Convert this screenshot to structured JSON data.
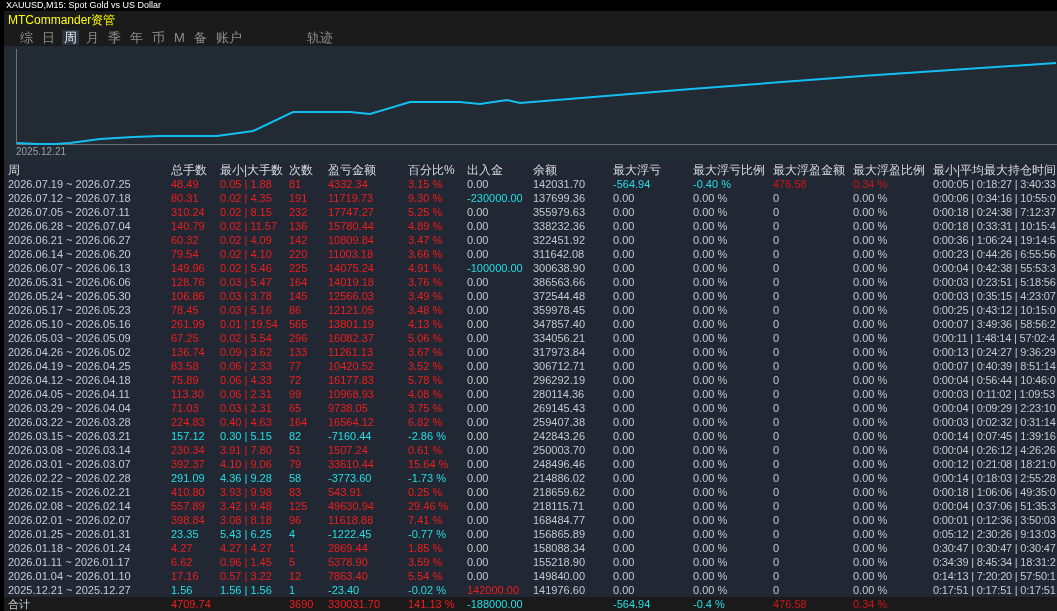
{
  "chart_window": {
    "title": "XAUUSD,M15: Spot Gold vs US Dollar"
  },
  "panel": {
    "title": "MTCommander资管"
  },
  "tabs": [
    {
      "label": "综",
      "selected": false
    },
    {
      "label": "日",
      "selected": false
    },
    {
      "label": "周",
      "selected": true
    },
    {
      "label": "月",
      "selected": false
    },
    {
      "label": "季",
      "selected": false
    },
    {
      "label": "年",
      "selected": false
    },
    {
      "label": "币",
      "selected": false
    },
    {
      "label": "M",
      "selected": false
    },
    {
      "label": "备",
      "selected": false
    },
    {
      "label": "账户",
      "selected": false
    }
  ],
  "trace_button": {
    "label": "轨迹"
  },
  "chart": {
    "start_label": "2025.12.21"
  },
  "table": {
    "columns": [
      "周",
      "总手数",
      "最小|大手数",
      "次数",
      "盈亏金额",
      "百分比%",
      "出入金",
      "余额",
      "最大浮亏",
      "最大浮亏比例",
      "最大浮盈金额",
      "最大浮盈比例",
      "最小|平均最大持仓时间"
    ],
    "rows": [
      {
        "cells": [
          "2026.07.19 ~ 2026.07.25",
          "48.49",
          "0.05 | 1.88",
          "81",
          "4332.34",
          "3.15 %",
          "0.00",
          "142031.70",
          "-564.94",
          "-0.40 %",
          "476.58",
          "0.34 %",
          "0:00:05 | 0:18:27 | 3:40:33"
        ],
        "loss": false,
        "deposit": false,
        "withdrawal": false,
        "has_floating": true
      },
      {
        "cells": [
          "2026.07.12 ~ 2026.07.18",
          "80.31",
          "0.02 | 4.35",
          "191",
          "11719.73",
          "9.30 %",
          "-230000.00",
          "137699.36",
          "0.00",
          "0.00 %",
          "0",
          "0.00 %",
          "0:00:06 | 0:34:16 | 10:55:0"
        ],
        "loss": false,
        "deposit": false,
        "withdrawal": true,
        "has_floating": false
      },
      {
        "cells": [
          "2026.07.05 ~ 2026.07.11",
          "310.24",
          "0.02 | 8.15",
          "232",
          "17747.27",
          "5.25 %",
          "0.00",
          "355979.63",
          "0.00",
          "0.00 %",
          "0",
          "0.00 %",
          "0:00:18 | 0:24:38 | 7:12:37"
        ],
        "loss": false,
        "deposit": false,
        "withdrawal": false,
        "has_floating": false
      },
      {
        "cells": [
          "2026.06.28 ~ 2026.07.04",
          "140.79",
          "0.02 | 11.57",
          "136",
          "15780.44",
          "4.89 %",
          "0.00",
          "338232.36",
          "0.00",
          "0.00 %",
          "0",
          "0.00 %",
          "0:00:18 | 0:33:31 | 10:15:4"
        ],
        "loss": false,
        "deposit": false,
        "withdrawal": false,
        "has_floating": false
      },
      {
        "cells": [
          "2026.06.21 ~ 2026.06.27",
          "60.32",
          "0.02 | 4.09",
          "142",
          "10809.84",
          "3.47 %",
          "0.00",
          "322451.92",
          "0.00",
          "0.00 %",
          "0",
          "0.00 %",
          "0:00:36 | 1:06:24 | 19:14:5"
        ],
        "loss": false,
        "deposit": false,
        "withdrawal": false,
        "has_floating": false
      },
      {
        "cells": [
          "2026.06.14 ~ 2026.06.20",
          "79.54",
          "0.02 | 4.10",
          "220",
          "11003.18",
          "3.66 %",
          "0.00",
          "311642.08",
          "0.00",
          "0.00 %",
          "0",
          "0.00 %",
          "0:00:23 | 0:44:26 | 6:55:56"
        ],
        "loss": false,
        "deposit": false,
        "withdrawal": false,
        "has_floating": false
      },
      {
        "cells": [
          "2026.06.07 ~ 2026.06.13",
          "149.96",
          "0.02 | 5.46",
          "225",
          "14075.24",
          "4.91 %",
          "-100000.00",
          "300638.90",
          "0.00",
          "0.00 %",
          "0",
          "0.00 %",
          "0:00:04 | 0:42:38 | 55:53:3"
        ],
        "loss": false,
        "deposit": false,
        "withdrawal": true,
        "has_floating": false
      },
      {
        "cells": [
          "2026.05.31 ~ 2026.06.06",
          "128.76",
          "0.03 | 5.47",
          "164",
          "14019.18",
          "3.76 %",
          "0.00",
          "386563.66",
          "0.00",
          "0.00 %",
          "0",
          "0.00 %",
          "0:00:03 | 0:23:51 | 5:18:56"
        ],
        "loss": false,
        "deposit": false,
        "withdrawal": false,
        "has_floating": false
      },
      {
        "cells": [
          "2026.05.24 ~ 2026.05.30",
          "106.86",
          "0.03 | 3.78",
          "145",
          "12566.03",
          "3.49 %",
          "0.00",
          "372544.48",
          "0.00",
          "0.00 %",
          "0",
          "0.00 %",
          "0:00:03 | 0:35:15 | 4:23:07"
        ],
        "loss": false,
        "deposit": false,
        "withdrawal": false,
        "has_floating": false
      },
      {
        "cells": [
          "2026.05.17 ~ 2026.05.23",
          "78.45",
          "0.03 | 5.16",
          "86",
          "12121.05",
          "3.48 %",
          "0.00",
          "359978.45",
          "0.00",
          "0.00 %",
          "0",
          "0.00 %",
          "0:00:25 | 0:43:12 | 10:15:0"
        ],
        "loss": false,
        "deposit": false,
        "withdrawal": false,
        "has_floating": false
      },
      {
        "cells": [
          "2026.05.10 ~ 2026.05.16",
          "261.99",
          "0.01 | 19.54",
          "565",
          "13801.19",
          "4.13 %",
          "0.00",
          "347857.40",
          "0.00",
          "0.00 %",
          "0",
          "0.00 %",
          "0:00:07 | 3:49:36 | 58:56:2"
        ],
        "loss": false,
        "deposit": false,
        "withdrawal": false,
        "has_floating": false
      },
      {
        "cells": [
          "2026.05.03 ~ 2026.05.09",
          "67.25",
          "0.02 | 5.54",
          "296",
          "16082.37",
          "5.06 %",
          "0.00",
          "334056.21",
          "0.00",
          "0.00 %",
          "0",
          "0.00 %",
          "0:00:11 | 1:48:14 | 57:02:4"
        ],
        "loss": false,
        "deposit": false,
        "withdrawal": false,
        "has_floating": false
      },
      {
        "cells": [
          "2026.04.26 ~ 2026.05.02",
          "136.74",
          "0.09 | 3.62",
          "133",
          "11261.13",
          "3.67 %",
          "0.00",
          "317973.84",
          "0.00",
          "0.00 %",
          "0",
          "0.00 %",
          "0:00:13 | 0:24:27 | 9:36:29"
        ],
        "loss": false,
        "deposit": false,
        "withdrawal": false,
        "has_floating": false
      },
      {
        "cells": [
          "2026.04.19 ~ 2026.04.25",
          "83.58",
          "0.06 | 2.33",
          "77",
          "10420.52",
          "3.52 %",
          "0.00",
          "306712.71",
          "0.00",
          "0.00 %",
          "0",
          "0.00 %",
          "0:00:07 | 0:40:39 | 8:51:14"
        ],
        "loss": false,
        "deposit": false,
        "withdrawal": false,
        "has_floating": false
      },
      {
        "cells": [
          "2026.04.12 ~ 2026.04.18",
          "75.89",
          "0.06 | 4.33",
          "72",
          "16177.83",
          "5.78 %",
          "0.00",
          "296292.19",
          "0.00",
          "0.00 %",
          "0",
          "0.00 %",
          "0:00:04 | 0:56:44 | 10:46:0"
        ],
        "loss": false,
        "deposit": false,
        "withdrawal": false,
        "has_floating": false
      },
      {
        "cells": [
          "2026.04.05 ~ 2026.04.11",
          "113.30",
          "0.06 | 2.31",
          "99",
          "10968.93",
          "4.08 %",
          "0.00",
          "280114.36",
          "0.00",
          "0.00 %",
          "0",
          "0.00 %",
          "0:00:03 | 0:11:02 | 1:09:53"
        ],
        "loss": false,
        "deposit": false,
        "withdrawal": false,
        "has_floating": false
      },
      {
        "cells": [
          "2026.03.29 ~ 2026.04.04",
          "71.03",
          "0.03 | 2.31",
          "65",
          "9738.05",
          "3.75 %",
          "0.00",
          "269145.43",
          "0.00",
          "0.00 %",
          "0",
          "0.00 %",
          "0:00:04 | 0:09:29 | 2:23:10"
        ],
        "loss": false,
        "deposit": false,
        "withdrawal": false,
        "has_floating": false
      },
      {
        "cells": [
          "2026.03.22 ~ 2026.03.28",
          "224.83",
          "0.40 | 4.63",
          "164",
          "16564.12",
          "6.82 %",
          "0.00",
          "259407.38",
          "0.00",
          "0.00 %",
          "0",
          "0.00 %",
          "0:00:03 | 0:02:32 | 0:31:14"
        ],
        "loss": false,
        "deposit": false,
        "withdrawal": false,
        "has_floating": false
      },
      {
        "cells": [
          "2026.03.15 ~ 2026.03.21",
          "157.12",
          "0.30 | 5.15",
          "82",
          "-7160.44",
          "-2.86 %",
          "0.00",
          "242843.26",
          "0.00",
          "0.00 %",
          "0",
          "0.00 %",
          "0:00:14 | 0:07:45 | 1:39:16"
        ],
        "loss": true,
        "deposit": false,
        "withdrawal": false,
        "has_floating": false
      },
      {
        "cells": [
          "2026.03.08 ~ 2026.03.14",
          "230.34",
          "3.91 | 7.80",
          "51",
          "1507.24",
          "0.61 %",
          "0.00",
          "250003.70",
          "0.00",
          "0.00 %",
          "0",
          "0.00 %",
          "0:00:04 | 0:26:12 | 4:26:26"
        ],
        "loss": false,
        "deposit": false,
        "withdrawal": false,
        "has_floating": false
      },
      {
        "cells": [
          "2026.03.01 ~ 2026.03.07",
          "392.37",
          "4.10 | 9.06",
          "79",
          "33610.44",
          "15.64 %",
          "0.00",
          "248496.46",
          "0.00",
          "0.00 %",
          "0",
          "0.00 %",
          "0:00:12 | 0:21:08 | 18:21:0"
        ],
        "loss": false,
        "deposit": false,
        "withdrawal": false,
        "has_floating": false
      },
      {
        "cells": [
          "2026.02.22 ~ 2026.02.28",
          "291.09",
          "4.36 | 9.28",
          "58",
          "-3773.60",
          "-1.73 %",
          "0.00",
          "214886.02",
          "0.00",
          "0.00 %",
          "0",
          "0.00 %",
          "0:00:14 | 0:18:03 | 2:55:28"
        ],
        "loss": true,
        "deposit": false,
        "withdrawal": false,
        "has_floating": false
      },
      {
        "cells": [
          "2026.02.15 ~ 2026.02.21",
          "410.80",
          "3.93 | 9.98",
          "83",
          "543.91",
          "0.25 %",
          "0.00",
          "218659.62",
          "0.00",
          "0.00 %",
          "0",
          "0.00 %",
          "0:00:18 | 1:06:06 | 49:35:0"
        ],
        "loss": false,
        "deposit": false,
        "withdrawal": false,
        "has_floating": false
      },
      {
        "cells": [
          "2026.02.08 ~ 2026.02.14",
          "557.89",
          "3.42 | 9.48",
          "125",
          "49630.94",
          "29.46 %",
          "0.00",
          "218115.71",
          "0.00",
          "0.00 %",
          "0",
          "0.00 %",
          "0:00:04 | 0:37:06 | 51:35:3"
        ],
        "loss": false,
        "deposit": false,
        "withdrawal": false,
        "has_floating": false
      },
      {
        "cells": [
          "2026.02.01 ~ 2026.02.07",
          "398.84",
          "3.08 | 8.18",
          "96",
          "11618.88",
          "7.41 %",
          "0.00",
          "168484.77",
          "0.00",
          "0.00 %",
          "0",
          "0.00 %",
          "0:00:01 | 0:12:36 | 3:50:03"
        ],
        "loss": false,
        "deposit": false,
        "withdrawal": false,
        "has_floating": false
      },
      {
        "cells": [
          "2026.01.25 ~ 2026.01.31",
          "23.35",
          "5.43 | 6.25",
          "4",
          "-1222.45",
          "-0.77 %",
          "0.00",
          "156865.89",
          "0.00",
          "0.00 %",
          "0",
          "0.00 %",
          "0:05:12 | 2:30:26 | 9:13:03"
        ],
        "loss": true,
        "deposit": false,
        "withdrawal": false,
        "has_floating": false
      },
      {
        "cells": [
          "2026.01.18 ~ 2026.01.24",
          "4.27",
          "4.27 | 4.27",
          "1",
          "2869.44",
          "1.85 %",
          "0.00",
          "158088.34",
          "0.00",
          "0.00 %",
          "0",
          "0.00 %",
          "0:30:47 | 0:30:47 | 0:30:47"
        ],
        "loss": false,
        "deposit": false,
        "withdrawal": false,
        "has_floating": false
      },
      {
        "cells": [
          "2026.01.11 ~ 2026.01.17",
          "6.62",
          "0.96 | 1.45",
          "5",
          "5378.90",
          "3.59 %",
          "0.00",
          "155218.90",
          "0.00",
          "0.00 %",
          "0",
          "0.00 %",
          "0:34:39 | 8:45:34 | 18:31:2"
        ],
        "loss": false,
        "deposit": false,
        "withdrawal": false,
        "has_floating": false
      },
      {
        "cells": [
          "2026.01.04 ~ 2026.01.10",
          "17.16",
          "0.57 | 3.22",
          "12",
          "7863.40",
          "5.54 %",
          "0.00",
          "149840.00",
          "0.00",
          "0.00 %",
          "0",
          "0.00 %",
          "0:14:13 | 7:20:20 | 57:50:1"
        ],
        "loss": false,
        "deposit": false,
        "withdrawal": false,
        "has_floating": false
      },
      {
        "cells": [
          "2025.12.21 ~ 2025.12.27",
          "1.56",
          "1.56 | 1.56",
          "1",
          "-23.40",
          "-0.02 %",
          "142000.00",
          "141976.60",
          "0.00",
          "0.00 %",
          "0",
          "0.00 %",
          "0:17:51 | 0:17:51 | 0:17:51"
        ],
        "loss": true,
        "deposit": true,
        "withdrawal": false,
        "has_floating": false
      }
    ],
    "total": {
      "label": "合计",
      "total_lots": "4709.74",
      "trades": "3690",
      "profit": "330031.70",
      "percent": "141.13 %",
      "cash_flow_amount": "-188000.00",
      "max_floating_loss": "-564.94",
      "max_floating_loss_ratio": "-0.4 %",
      "max_floating_profit": "476.58",
      "max_floating_profit_ratio": "0.34 %",
      "loss": false,
      "deposit": false,
      "withdrawal": true,
      "has_floating": true
    }
  }
}
